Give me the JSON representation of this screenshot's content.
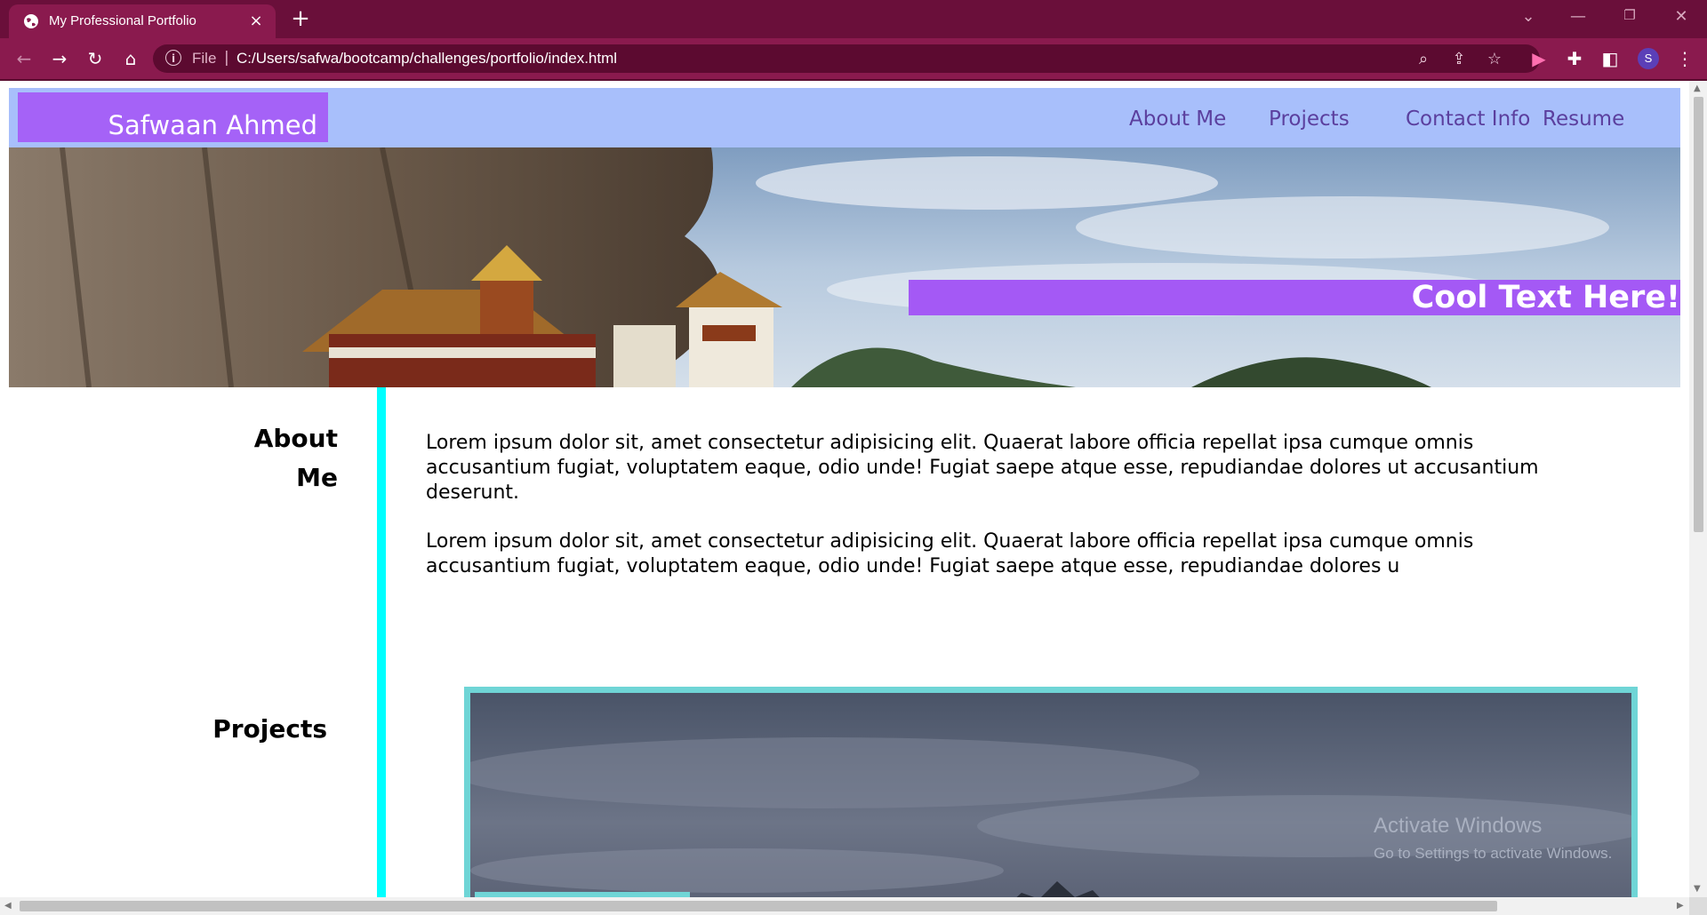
{
  "browser": {
    "tab_title": "My Professional Portfolio",
    "tab_close": "×",
    "new_tab": "+",
    "address": {
      "scheme_label": "File",
      "separator": "|",
      "url": "C:/Users/safwa/bootcamp/challenges/portfolio/index.html"
    },
    "profile_initial": "S",
    "accent_color": "#8a1a4e"
  },
  "site": {
    "logo": "Safwaan Ahmed",
    "nav": [
      "About Me",
      "Projects",
      "Contact Info",
      "Resume"
    ],
    "hero_text": "Cool Text Here!",
    "about": {
      "title_line1": "About",
      "title_line2": "Me",
      "paragraphs": [
        "Lorem ipsum dolor sit, amet consectetur adipisicing elit. Quaerat labore officia repellat ipsa cumque omnis accusantium fugiat, voluptatem eaque, odio unde! Fugiat saepe atque esse, repudiandae dolores ut accusantium deserunt.",
        "Lorem ipsum dolor sit, amet consectetur adipisicing elit. Quaerat labore officia repellat ipsa cumque omnis accusantium fugiat, voluptatem eaque, odio unde! Fugiat saepe atque esse, repudiandae dolores u"
      ]
    },
    "projects": {
      "title": "Projects"
    },
    "colors": {
      "header_bg": "#a8bffb",
      "logo_bg": "#a562f7",
      "nav_text": "#5b3f9e",
      "banner_bg": "#a459f5",
      "divider": "#00ffff",
      "project_border": "#6fd5d6"
    }
  },
  "os_watermark": {
    "line1": "Activate Windows",
    "line2": "Go to Settings to activate Windows."
  }
}
